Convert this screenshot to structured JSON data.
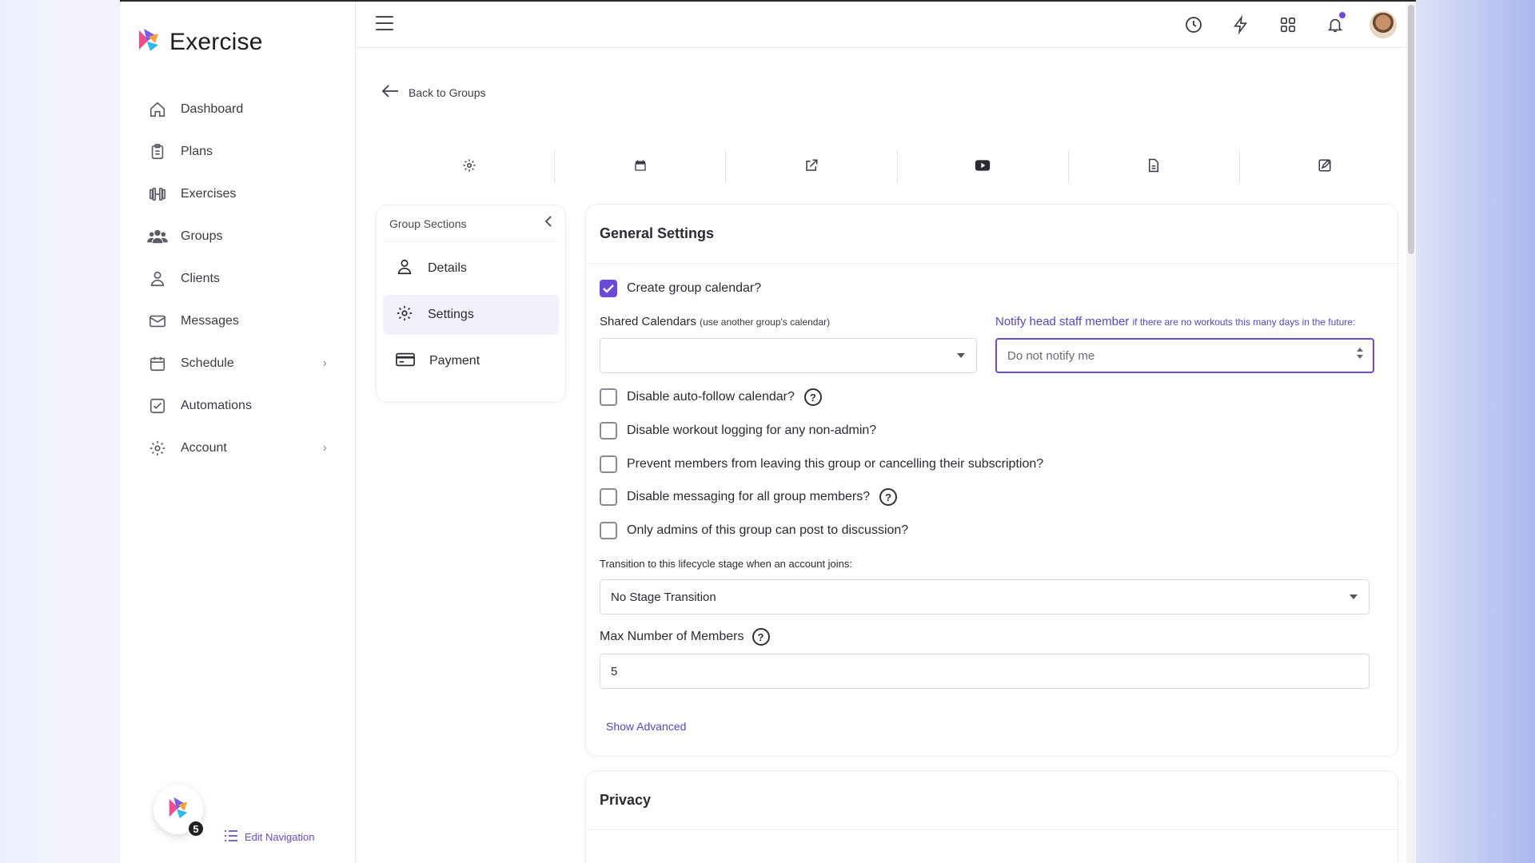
{
  "app": {
    "name": "Exercise"
  },
  "sidebar": {
    "items": [
      {
        "label": "Dashboard",
        "icon": "home-icon"
      },
      {
        "label": "Plans",
        "icon": "clipboard-icon"
      },
      {
        "label": "Exercises",
        "icon": "dumbbell-icon"
      },
      {
        "label": "Groups",
        "icon": "users-icon"
      },
      {
        "label": "Clients",
        "icon": "user-icon"
      },
      {
        "label": "Messages",
        "icon": "mail-icon"
      },
      {
        "label": "Schedule",
        "icon": "calendar-icon",
        "has_submenu": true
      },
      {
        "label": "Automations",
        "icon": "checkbox-icon"
      },
      {
        "label": "Account",
        "icon": "gear-icon",
        "has_submenu": true
      }
    ],
    "footer": {
      "badge_count": "5",
      "edit_label": "Edit Navigation"
    }
  },
  "topbar": {
    "notification_dot_color": "#6a4ad6"
  },
  "back_link": "Back to Groups",
  "tabs": [
    "gear-icon",
    "calendar-icon",
    "external-link-icon",
    "youtube-icon",
    "document-icon",
    "edit-square-icon"
  ],
  "group_sections": {
    "title": "Group Sections",
    "items": [
      {
        "label": "Details",
        "icon": "user-icon",
        "active": false
      },
      {
        "label": "Settings",
        "icon": "gear-icon",
        "active": true
      },
      {
        "label": "Payment",
        "icon": "credit-card-icon",
        "active": false
      }
    ]
  },
  "general_settings": {
    "title": "General Settings",
    "create_calendar": {
      "label": "Create group calendar?",
      "checked": true
    },
    "shared_calendars": {
      "label": "Shared Calendars",
      "hint": "(use another group's calendar)",
      "value": ""
    },
    "notify": {
      "label": "Notify head staff member",
      "hint": "if there are no workouts this many days in the future:",
      "placeholder": "Do not notify me"
    },
    "options": [
      {
        "label": "Disable auto-follow calendar?",
        "checked": false,
        "help": true
      },
      {
        "label": "Disable workout logging for any non-admin?",
        "checked": false,
        "help": false
      },
      {
        "label": "Prevent members from leaving this group or cancelling their subscription?",
        "checked": false,
        "help": false
      },
      {
        "label": "Disable messaging for all group members?",
        "checked": false,
        "help": true
      },
      {
        "label": "Only admins of this group can post to discussion?",
        "checked": false,
        "help": false
      }
    ],
    "lifecycle": {
      "label": "Transition to this lifecycle stage when an account joins:",
      "value": "No Stage Transition"
    },
    "max_members": {
      "label": "Max Number of Members",
      "value": "5"
    },
    "show_advanced": "Show Advanced"
  },
  "privacy": {
    "title": "Privacy"
  },
  "colors": {
    "accent": "#6a4ad6"
  }
}
